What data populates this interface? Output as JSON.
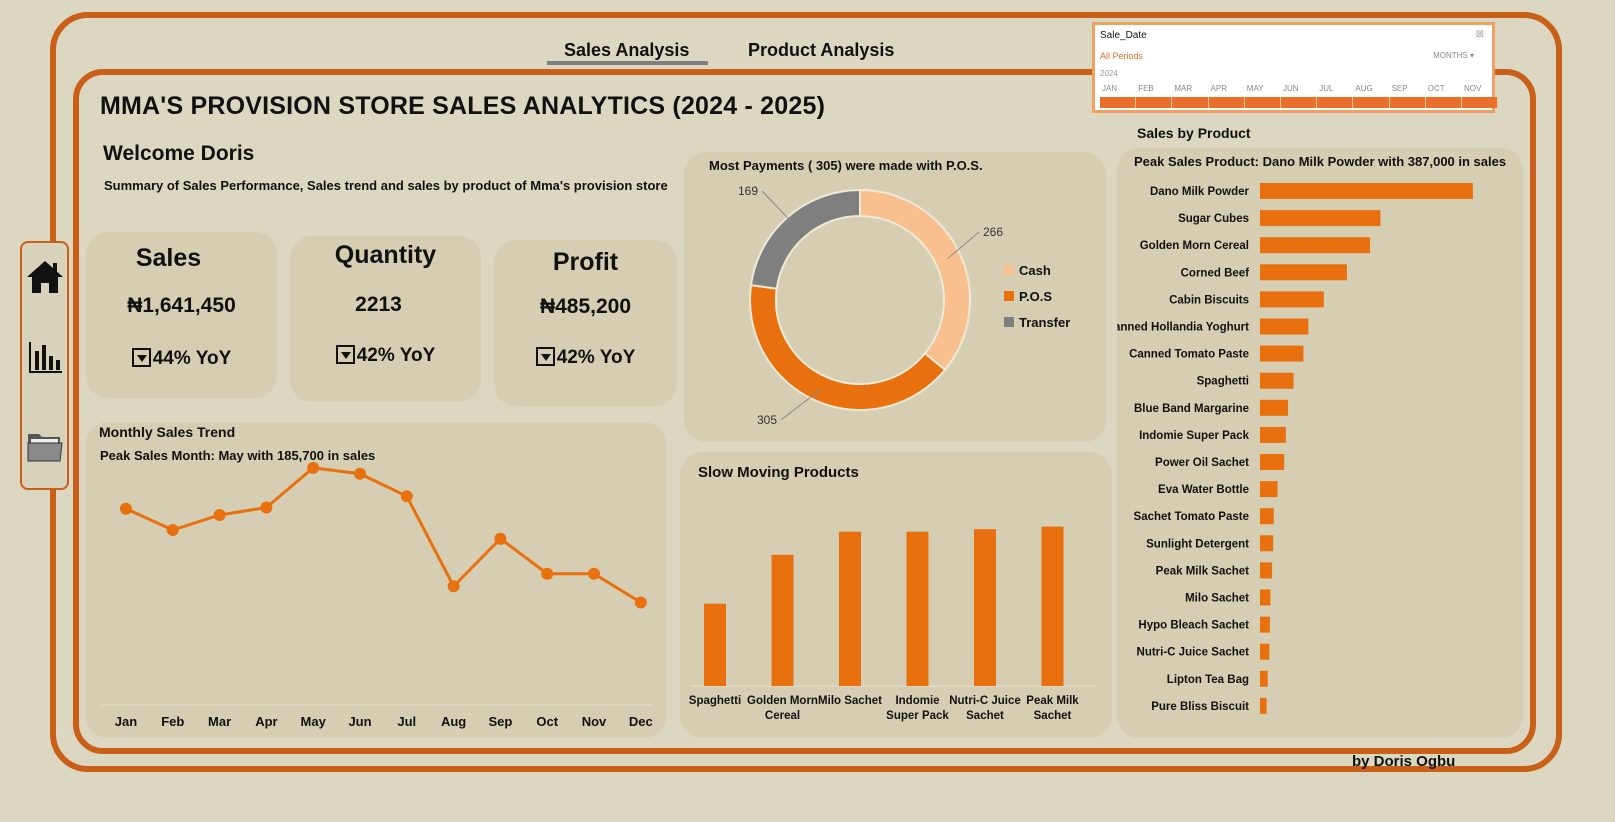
{
  "nav": {
    "tabs": [
      "Sales Analysis",
      "Product Analysis"
    ]
  },
  "sidebar": {
    "icons": [
      "home-icon",
      "bar-chart-icon",
      "folder-icon"
    ]
  },
  "header": {
    "title": "MMA'S PROVISION STORE SALES ANALYTICS (2024 - 2025)",
    "welcome": "Welcome Doris",
    "summary": "Summary of Sales Performance, Sales trend and  sales by product of Mma's provision store"
  },
  "kpis": {
    "sales": {
      "label": "Sales",
      "value": "₦1,641,450",
      "yoy": "44% YoY"
    },
    "quantity": {
      "label": "Quantity",
      "value": "2213",
      "yoy": "42% YoY"
    },
    "profit": {
      "label": "Profit",
      "value": "₦485,200",
      "yoy": "42% YoY"
    }
  },
  "slicer": {
    "title": "Sale_Date",
    "selection": "All Periods",
    "level": "MONTHS",
    "year": "2024",
    "months": [
      "JAN",
      "FEB",
      "MAR",
      "APR",
      "MAY",
      "JUN",
      "JUL",
      "AUG",
      "SEP",
      "OCT",
      "NOV"
    ]
  },
  "footer": {
    "credit": "by Doris Ogbu"
  },
  "colors": {
    "accent": "#e8700f",
    "frame": "#c8601a",
    "background": "#dcd7c1",
    "panel": "#d5ceb3",
    "cash": "#f8bf8f",
    "transfer": "#7f7f7f"
  },
  "chart_data": [
    {
      "id": "payments",
      "type": "pie",
      "subtitle": "Most Payments ( 305) were made with P.O.S.",
      "labels": [
        "Cash",
        "P.O.S",
        "Transfer"
      ],
      "values": [
        266,
        305,
        169
      ],
      "legend": "right"
    },
    {
      "id": "monthly",
      "type": "line",
      "title": "Monthly Sales Trend",
      "subtitle": "Peak Sales Month: May with 185,700 in sales",
      "categories": [
        "Jan",
        "Feb",
        "Mar",
        "Apr",
        "May",
        "Jun",
        "Jul",
        "Aug",
        "Sep",
        "Oct",
        "Nov",
        "Dec"
      ],
      "values": [
        153000,
        136000,
        148000,
        154000,
        185700,
        181000,
        163000,
        91000,
        129000,
        101000,
        101000,
        78000
      ],
      "ylim": [
        0,
        200000
      ],
      "grid": false
    },
    {
      "id": "slow",
      "type": "bar",
      "title": "Slow Moving Products",
      "categories": [
        "Spaghetti",
        "Golden Morn Cereal",
        "Milo Sachet",
        "Indomie Super Pack",
        "Nutri-C Juice Sachet",
        "Peak Milk Sachet"
      ],
      "values": [
        32,
        51,
        60,
        60,
        61,
        62
      ],
      "ylim": [
        0,
        70
      ]
    },
    {
      "id": "product",
      "type": "bar",
      "orientation": "horizontal",
      "title": "Sales by Product",
      "subtitle": "Peak Sales Product: Dano Milk Powder with 387,000 in sales",
      "categories": [
        "Dano Milk Powder",
        "Sugar Cubes",
        "Golden Morn Cereal",
        "Corned Beef",
        "Cabin Biscuits",
        "Canned Hollandia Yoghurt",
        "Canned Tomato Paste",
        "Spaghetti",
        "Blue Band Margarine",
        "Indomie Super Pack",
        "Power Oil Sachet",
        "Eva Water Bottle",
        "Sachet Tomato Paste",
        "Sunlight Detergent",
        "Peak Milk Sachet",
        "Milo Sachet",
        "Hypo Bleach Sachet",
        "Nutri-C Juice Sachet",
        "Lipton Tea Bag",
        "Pure Bliss Biscuit"
      ],
      "values": [
        387000,
        219000,
        200000,
        158000,
        116000,
        88000,
        79000,
        61000,
        51000,
        47000,
        44000,
        32000,
        25000,
        24000,
        22000,
        19000,
        18000,
        17000,
        14000,
        12000
      ],
      "xlim": [
        0,
        400000
      ]
    }
  ]
}
